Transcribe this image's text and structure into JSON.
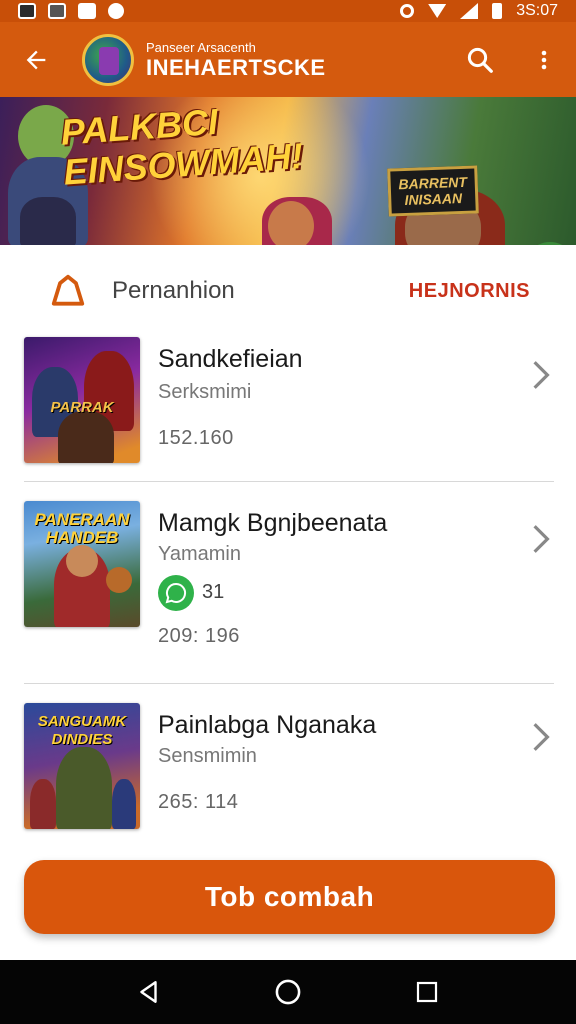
{
  "status_bar": {
    "time": "3S:07",
    "icons": [
      "gallery-icon",
      "shield-icon",
      "lock-icon",
      "face-icon",
      "vibrate-icon",
      "wifi-icon",
      "signal-icon",
      "battery-icon"
    ]
  },
  "app_bar": {
    "subtitle": "Panseer Arsacenth",
    "title": "INEHAERTSCKE",
    "icons": [
      "back-arrow-icon",
      "search-icon",
      "more-vert-icon"
    ]
  },
  "banner": {
    "title_line1": "PALKBCI",
    "title_line2": "EINSOWMAH!",
    "sign_line1": "BARRENT",
    "sign_line2": "INISAAN"
  },
  "section": {
    "icon": "home-outline-icon",
    "title": "Pernanhion",
    "link": "HEJNORNIS"
  },
  "games": [
    {
      "name": "Sandkefieian",
      "developer": "Serksmimi",
      "count": "152.160",
      "thumb_title": "PARRAK"
    },
    {
      "name": "Mamgk Bgnjbeenata",
      "developer": "Yamamin",
      "badge_count": "31",
      "count": "209: 196",
      "thumb_title": "PANERAAN HANDEB"
    },
    {
      "name": "Painlabga Nganaka",
      "developer": "Sensmimin",
      "count": "265: 114",
      "thumb_title": "SANGUAMK DINDIES"
    }
  ],
  "cta": {
    "label": "Tob combah"
  },
  "colors": {
    "app_bar": "#d45a0e",
    "status_bar": "#c84f08",
    "accent_link": "#c8321a",
    "cta": "#d9560c",
    "badge": "#2fb24a",
    "nav_bar": "#050505"
  },
  "nav_bar": {
    "icons": [
      "nav-back-icon",
      "nav-home-icon",
      "nav-recents-icon"
    ]
  }
}
